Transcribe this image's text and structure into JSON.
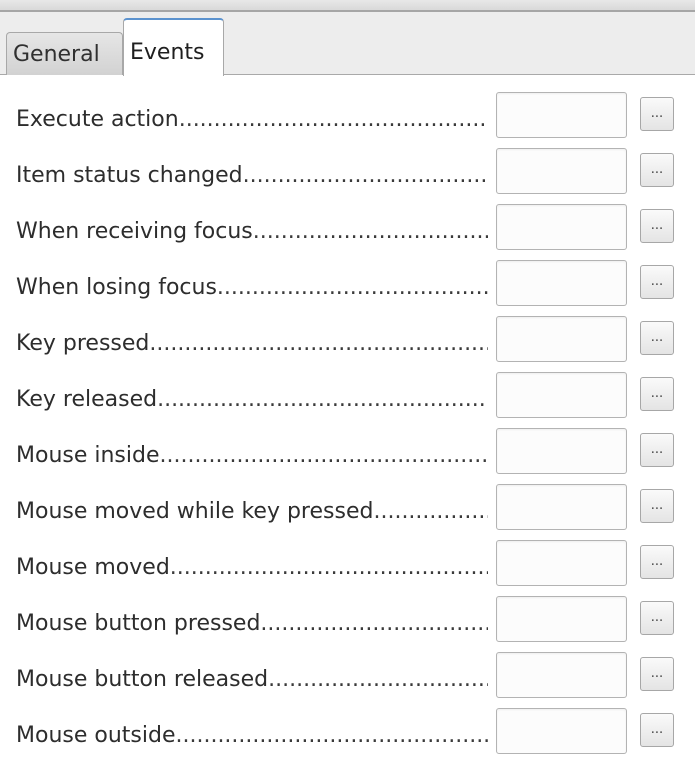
{
  "tabs": [
    {
      "label": "General",
      "active": false
    },
    {
      "label": "Events",
      "active": true
    }
  ],
  "events": [
    {
      "label": "Execute action",
      "value": "",
      "button_label": "..."
    },
    {
      "label": "Item status changed",
      "value": "",
      "button_label": "..."
    },
    {
      "label": "When receiving focus",
      "value": "",
      "button_label": "..."
    },
    {
      "label": "When losing focus",
      "value": "",
      "button_label": "..."
    },
    {
      "label": "Key pressed",
      "value": "",
      "button_label": "..."
    },
    {
      "label": "Key released",
      "value": "",
      "button_label": "..."
    },
    {
      "label": "Mouse inside",
      "value": "",
      "button_label": "..."
    },
    {
      "label": "Mouse moved while key pressed",
      "value": "",
      "button_label": "..."
    },
    {
      "label": "Mouse moved",
      "value": "",
      "button_label": "..."
    },
    {
      "label": "Mouse button pressed",
      "value": "",
      "button_label": "..."
    },
    {
      "label": "Mouse button released",
      "value": "",
      "button_label": "..."
    },
    {
      "label": "Mouse outside",
      "value": "",
      "button_label": "..."
    }
  ],
  "colors": {
    "active_tab_accent": "#5c93cf",
    "tab_strip_background": "#ededed",
    "panel_background": "#ffffff"
  }
}
